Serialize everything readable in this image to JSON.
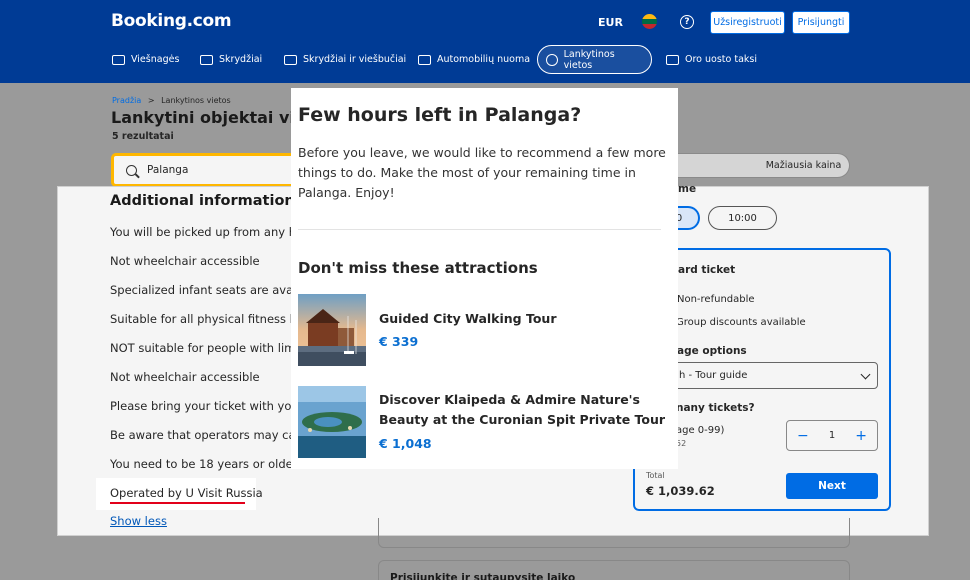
{
  "header": {
    "logo": "Booking.com",
    "currency": "EUR",
    "help_glyph": "?",
    "register_label": "Užsiregistruoti",
    "login_label": "Prisijungti",
    "nav": [
      {
        "label": "Viešnagės",
        "icon": "bed-icon"
      },
      {
        "label": "Skrydžiai",
        "icon": "plane-icon"
      },
      {
        "label": "Skrydžiai ir viešbučiai",
        "icon": "plane-hotel-icon"
      },
      {
        "label": "Automobilių nuoma",
        "icon": "car-icon"
      },
      {
        "label": "Lankytinos vietos",
        "icon": "attractions-icon",
        "active": true
      },
      {
        "label": "Oro uosto taksi",
        "icon": "taxi-icon"
      }
    ]
  },
  "page": {
    "breadcrumb_home": "Pradžia",
    "breadcrumb_sep": ">",
    "breadcrumb_current": "Lankytinos vietos",
    "title": "Lankytini objektai vieto",
    "results": "5 rezultatai",
    "search_value": "Palanga",
    "sort_label": "Mažiausia kaina"
  },
  "details": {
    "heading": "Additional information",
    "lines": [
      "You will be picked up from any hote",
      "Not wheelchair accessible",
      "Specialized infant seats are availabl",
      "Suitable for all physical fitness level",
      "NOT suitable for people with limite",
      "Not wheelchair accessible",
      "Please bring your ticket with you to",
      "Be aware that operators may cance",
      "You need to be 18 years or older to"
    ],
    "operated_by": "Operated by U Visit Russia",
    "show_less": "Show less"
  },
  "booking": {
    "time_label": "me",
    "times": [
      "0",
      "10:00"
    ],
    "ticket_title": "ard ticket",
    "features": [
      "Non-refundable",
      "Group discounts available"
    ],
    "language_label": "age options",
    "language_value": "h - Tour guide",
    "tickets_label": "nany tickets?",
    "age_range": "age 0-99)",
    "age_price": "52",
    "quantity": "1",
    "minus": "−",
    "plus": "+",
    "total_label": "Total",
    "total_value": "€ 1,039.62",
    "next_label": "Next",
    "below_text": "Prisijunkite ir sutaupysite laiko"
  },
  "popup": {
    "title": "Few hours left in Palanga?",
    "body": "Before you leave, we would like to recommend a few more things to do. Make the most of your remaining time in Palanga. Enjoy!",
    "subtitle": "Don't miss these attractions",
    "attractions": [
      {
        "name": "Guided City Walking Tour",
        "price": "€ 339"
      },
      {
        "name": "Discover Klaipeda & Admire Nature's Beauty at the Curonian Spit Private Tour",
        "price": "€ 1,048"
      }
    ]
  },
  "colors": {
    "brand_blue": "#003b95",
    "link_blue": "#006ce4",
    "price_blue": "#0b6fd1",
    "highlight_red": "#e2001a",
    "search_border": "#ffb700"
  }
}
